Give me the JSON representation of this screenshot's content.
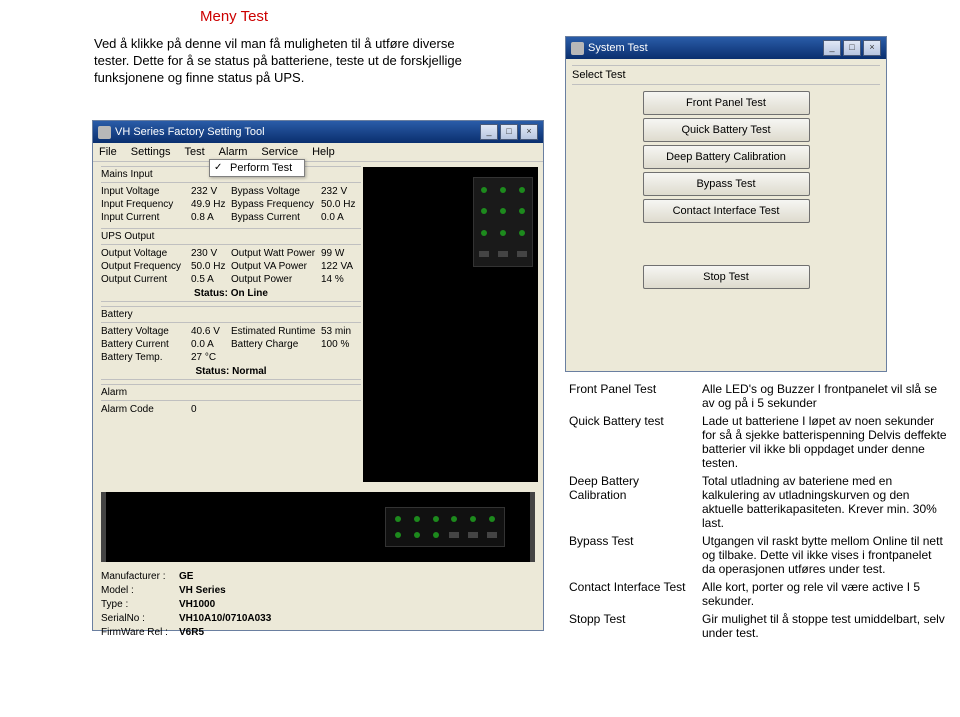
{
  "title": "Meny Test",
  "intro": "Ved å klikke på denne vil man få muligheten til å utføre diverse tester. Dette for å se status på batteriene, teste ut de forskjellige funksjonene og finne status på UPS.",
  "mainWindow": {
    "title": "VH Series Factory Setting Tool",
    "menu": [
      "File",
      "Settings",
      "Test",
      "Alarm",
      "Service",
      "Help"
    ],
    "dropdown": "Perform Test",
    "sections": {
      "mainsInput": {
        "title": "Mains Input",
        "inputVoltage_lbl": "Input Voltage",
        "inputVoltage_val": "232 V",
        "bypassVoltage_lbl": "Bypass Voltage",
        "bypassVoltage_val": "232 V",
        "inputFreq_lbl": "Input Frequency",
        "inputFreq_val": "49.9 Hz",
        "bypassFreq_lbl": "Bypass Frequency",
        "bypassFreq_val": "50.0 Hz",
        "inputCurrent_lbl": "Input Current",
        "inputCurrent_val": "0.8 A",
        "bypassCurrent_lbl": "Bypass Current",
        "bypassCurrent_val": "0.0 A"
      },
      "upsOutput": {
        "title": "UPS Output",
        "outVoltage_lbl": "Output Voltage",
        "outVoltage_val": "230 V",
        "outWatt_lbl": "Output Watt Power",
        "outWatt_val": "99 W",
        "outFreq_lbl": "Output Frequency",
        "outFreq_val": "50.0 Hz",
        "outVA_lbl": "Output VA Power",
        "outVA_val": "122 VA",
        "outCurrent_lbl": "Output Current",
        "outCurrent_val": "0.5 A",
        "outPower_lbl": "Output Power",
        "outPower_val": "14 %",
        "status": "Status: On Line"
      },
      "battery": {
        "title": "Battery",
        "bv_lbl": "Battery Voltage",
        "bv_val": "40.6 V",
        "er_lbl": "Estimated Runtime",
        "er_val": "53 min",
        "bc_lbl": "Battery Current",
        "bc_val": "0.0 A",
        "bch_lbl": "Battery Charge",
        "bch_val": "100 %",
        "bt_lbl": "Battery Temp.",
        "bt_val": "27 °C",
        "status": "Status: Normal"
      },
      "alarm": {
        "title": "Alarm",
        "ac_lbl": "Alarm Code",
        "ac_val": "0"
      }
    },
    "info": {
      "manufacturer_lbl": "Manufacturer :",
      "manufacturer": "GE",
      "model_lbl": "Model :",
      "model": "VH Series",
      "type_lbl": "Type :",
      "type": "VH1000",
      "serial_lbl": "SerialNo :",
      "serial": "VH10A10/0710A033",
      "fw_lbl": "FirmWare Rel :",
      "fw": "V6R5"
    }
  },
  "systemTest": {
    "title": "System Test",
    "selectLabel": "Select Test",
    "buttons": [
      "Front Panel Test",
      "Quick Battery Test",
      "Deep Battery Calibration",
      "Bypass Test",
      "Contact Interface Test"
    ],
    "stop": "Stop Test"
  },
  "descriptions": [
    {
      "name": "Front Panel Test",
      "text": "Alle LED's og Buzzer I frontpanelet vil slå se av og på i 5 sekunder"
    },
    {
      "name": "Quick Battery test",
      "text": "Lade ut batteriene I løpet av noen sekunder for så å sjekke batterispenning Delvis deffekte batterier vil ikke bli oppdaget under denne testen."
    },
    {
      "name": "Deep Battery Calibration",
      "text": "Total utladning av bateriene med en kalkulering av utladningskurven og den aktuelle batterikapasiteten. Krever min. 30% last."
    },
    {
      "name": "Bypass Test",
      "text": "Utgangen vil raskt bytte mellom Online til nett og tilbake. Dette vil ikke vises i frontpanelet da operasjonen utføres under test."
    },
    {
      "name": "Contact Interface Test",
      "text": "Alle kort, porter og rele vil være active I 5 sekunder."
    },
    {
      "name": "Stopp Test",
      "text": "Gir mulighet til å stoppe test umiddelbart, selv under test."
    }
  ]
}
